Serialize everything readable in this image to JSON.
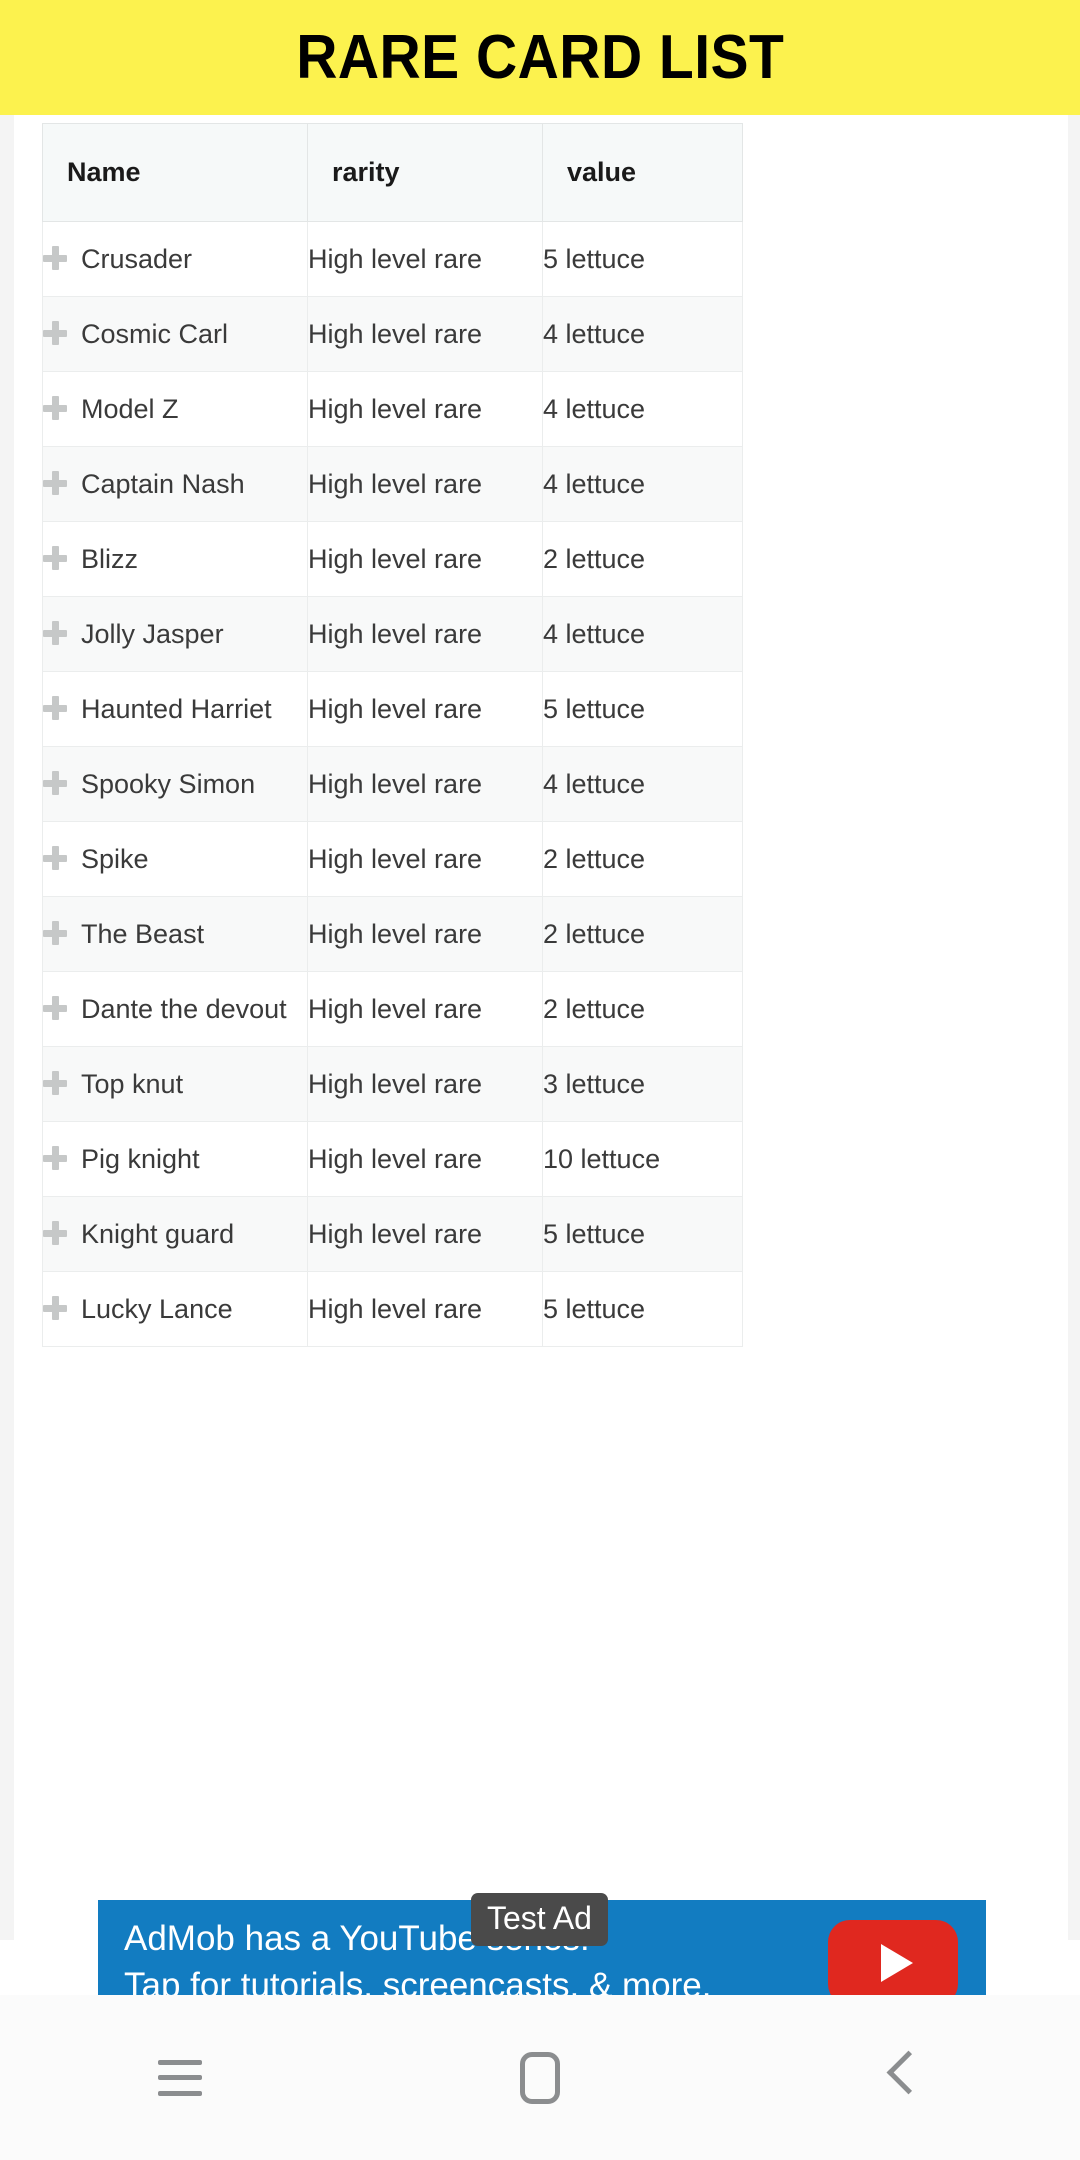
{
  "app": {
    "title": "RARE CARD LIST",
    "title_bar_color": "#FCF24E"
  },
  "table": {
    "columns": [
      "Name",
      "rarity",
      "value"
    ],
    "row_icon": "plus-icon",
    "rows": [
      {
        "name": "Crusader",
        "rarity": "High level rare",
        "value": "5 lettuce"
      },
      {
        "name": "Cosmic Carl",
        "rarity": "High level rare",
        "value": "4 lettuce"
      },
      {
        "name": "Model Z",
        "rarity": "High level rare",
        "value": "4 lettuce"
      },
      {
        "name": "Captain Nash",
        "rarity": "High level rare",
        "value": "4 lettuce"
      },
      {
        "name": "Blizz",
        "rarity": "High level rare",
        "value": "2 lettuce"
      },
      {
        "name": "Jolly Jasper",
        "rarity": "High level rare",
        "value": "4 lettuce"
      },
      {
        "name": "Haunted Harriet",
        "rarity": "High level rare",
        "value": "5 lettuce"
      },
      {
        "name": "Spooky Simon",
        "rarity": "High level rare",
        "value": "4 lettuce"
      },
      {
        "name": "Spike",
        "rarity": "High level rare",
        "value": "2 lettuce"
      },
      {
        "name": "The Beast",
        "rarity": "High level rare",
        "value": "2 lettuce"
      },
      {
        "name": "Dante the devout",
        "rarity": "High level rare",
        "value": "2 lettuce"
      },
      {
        "name": "Top knut",
        "rarity": "High level rare",
        "value": "3 lettuce"
      },
      {
        "name": "Pig knight",
        "rarity": "High level rare",
        "value": "10 lettuce"
      },
      {
        "name": "Knight guard",
        "rarity": "High level rare",
        "value": "5 lettuce"
      },
      {
        "name": "Lucky Lance",
        "rarity": "High level rare",
        "value": "5 lettuce"
      }
    ]
  },
  "ad": {
    "badge": "Test Ad",
    "line1": "AdMob has a YouTube series!",
    "line2": "Tap for tutorials, screencasts, & more.",
    "background_color": "#127cc1",
    "button_color": "#e0281f",
    "button_icon": "play-icon"
  },
  "navbar": {
    "recents_icon": "recents-icon",
    "home_icon": "home-icon",
    "back_icon": "back-icon"
  }
}
